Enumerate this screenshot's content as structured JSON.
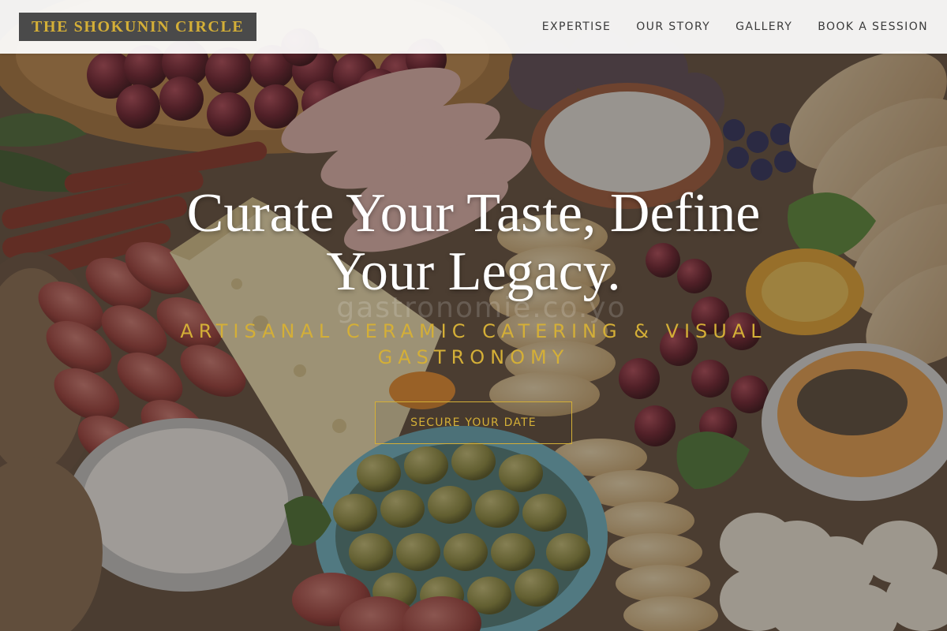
{
  "header": {
    "logo_text": "THE SHOKUNIN CIRCLE",
    "nav": [
      {
        "label": "EXPERTISE"
      },
      {
        "label": "OUR STORY"
      },
      {
        "label": "GALLERY"
      },
      {
        "label": "BOOK A SESSION"
      }
    ]
  },
  "hero": {
    "title_line1": "Curate Your Taste, Define",
    "title_line2": "Your Legacy.",
    "subtitle_line1": "ARTISANAL CERAMIC CATERING & VISUAL",
    "subtitle_line2": "GASTRONOMY",
    "watermark_text": "gastronomie.co.yo",
    "cta_label": "SECURE YOUR DATE",
    "background": "charcuterie-board-photo"
  },
  "colors": {
    "accent_gold": "#d4af37",
    "logo_bg": "#4a4a4a",
    "header_bg": "#ffffff",
    "nav_text": "#3a3a3a"
  }
}
